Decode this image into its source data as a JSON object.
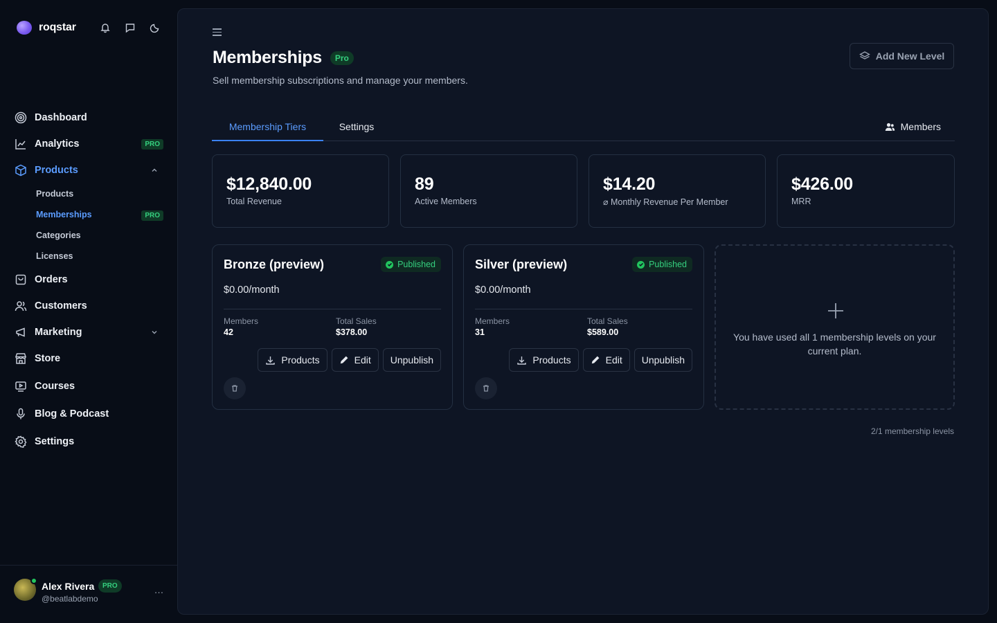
{
  "brand": {
    "name": "roqstar"
  },
  "sidebar": {
    "items": [
      {
        "label": "Dashboard"
      },
      {
        "label": "Analytics",
        "badge": "PRO"
      },
      {
        "label": "Products"
      },
      {
        "label": "Orders"
      },
      {
        "label": "Customers"
      },
      {
        "label": "Marketing"
      },
      {
        "label": "Store"
      },
      {
        "label": "Courses"
      },
      {
        "label": "Blog & Podcast"
      },
      {
        "label": "Settings"
      }
    ],
    "product_sub": [
      {
        "label": "Products"
      },
      {
        "label": "Memberships",
        "badge": "PRO"
      },
      {
        "label": "Categories"
      },
      {
        "label": "Licenses"
      }
    ]
  },
  "profile": {
    "name": "Alex Rivera",
    "badge": "PRO",
    "handle": "@beatlabdemo",
    "more": "…"
  },
  "header": {
    "title": "Memberships",
    "badge": "Pro",
    "subtitle": "Sell membership subscriptions and manage your members.",
    "add_button": "Add New Level"
  },
  "tabs": {
    "tiers": "Membership Tiers",
    "settings": "Settings",
    "members": "Members"
  },
  "stats": [
    {
      "value": "$12,840.00",
      "label": "Total Revenue"
    },
    {
      "value": "89",
      "label": "Active Members"
    },
    {
      "value": "$14.20",
      "label": "⌀ Monthly Revenue Per Member"
    },
    {
      "value": "$426.00",
      "label": "MRR"
    }
  ],
  "tiers": [
    {
      "name": "Bronze (preview)",
      "status": "Published",
      "price": "$0.00/month",
      "members_label": "Members",
      "members": "42",
      "sales_label": "Total Sales",
      "sales": "$378.00",
      "btn_products": "Products",
      "btn_edit": "Edit",
      "btn_unpublish": "Unpublish"
    },
    {
      "name": "Silver (preview)",
      "status": "Published",
      "price": "$0.00/month",
      "members_label": "Members",
      "members": "31",
      "sales_label": "Total Sales",
      "sales": "$589.00",
      "btn_products": "Products",
      "btn_edit": "Edit",
      "btn_unpublish": "Unpublish"
    }
  ],
  "add_level": {
    "text": "You have used all 1 membership levels on your current plan."
  },
  "levels_count": "2/1 membership levels",
  "colors": {
    "accent": "#3b82f6",
    "accent_text": "#5b9cff",
    "success": "#22c55e",
    "background": "#080d17",
    "panel": "#0e1524"
  }
}
